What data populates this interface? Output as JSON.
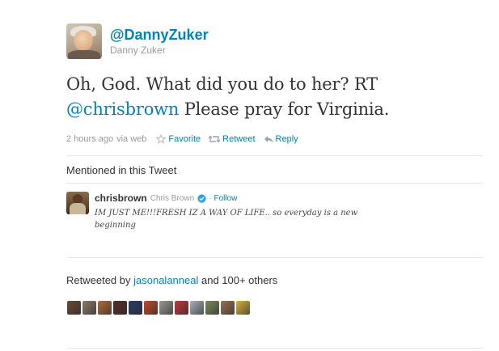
{
  "author": {
    "screen_name": "@DannyZuker",
    "full_name": "Danny Zuker"
  },
  "tweet": {
    "line1": "Oh, God. What did you do to her? RT",
    "mention": "@chrisbrown",
    "line2_rest": " Please pray for Virginia."
  },
  "meta": {
    "time": "2 hours ago",
    "via": "via web",
    "favorite_label": "Favorite",
    "retweet_label": "Retweet",
    "reply_label": "Reply",
    "favorite_icon": "star-icon",
    "retweet_icon": "retweet-icon",
    "reply_icon": "reply-icon"
  },
  "mentioned_section": {
    "title": "Mentioned in this Tweet",
    "user": {
      "screen_name": "chrisbrown",
      "full_name": "Chris Brown",
      "verified_icon": "verified-badge-icon",
      "follow_label": "Follow",
      "bio_line1": "IM JUST ME!!!FRESH IZ A WAY OF LIFE.. so everyday is a new",
      "bio_line2": "beginning"
    }
  },
  "retweeted": {
    "prefix": "Retweeted by",
    "user": "jasonalanneal",
    "suffix": "and 100+ others",
    "avatar_colors": [
      "#6b4a35",
      "#8a7a68",
      "#b06a3a",
      "#5a2a2a",
      "#2a3a6a",
      "#c04a2a",
      "#9a9a92",
      "#c03a3a",
      "#aab0b8",
      "#7a8a5a",
      "#9a7050",
      "#d8b040"
    ]
  },
  "colors": {
    "link": "#0084b4",
    "text": "#333333",
    "muted": "#999999"
  }
}
